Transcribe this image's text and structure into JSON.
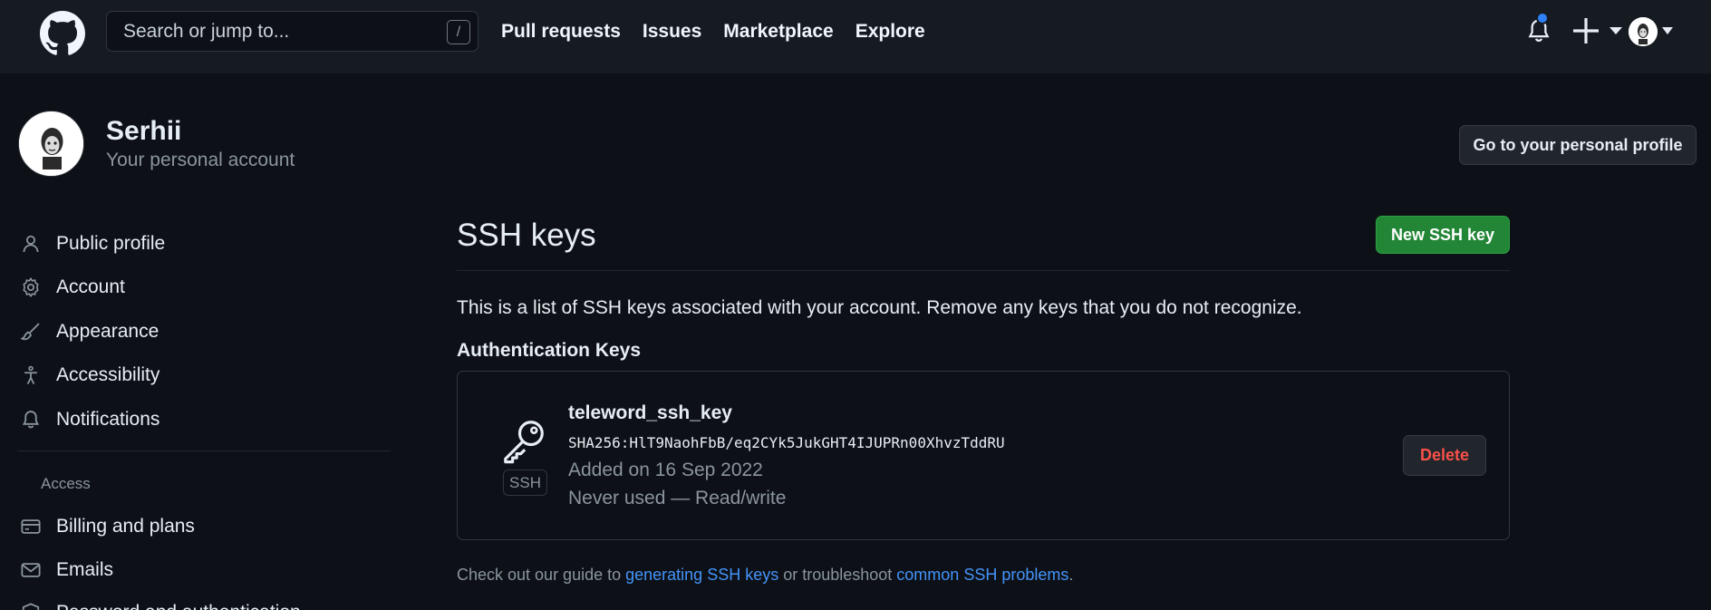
{
  "header": {
    "search_placeholder": "Search or jump to...",
    "search_shortcut": "/",
    "nav": [
      "Pull requests",
      "Issues",
      "Marketplace",
      "Explore"
    ],
    "icons": [
      "github-logo-icon",
      "bell-icon",
      "plus-icon",
      "avatar"
    ]
  },
  "profile": {
    "name": "Serhii",
    "subtitle": "Your personal account",
    "go_profile_button": "Go to your personal profile"
  },
  "sidebar": {
    "items": [
      {
        "label": "Public profile",
        "icon": "person-icon"
      },
      {
        "label": "Account",
        "icon": "gear-icon"
      },
      {
        "label": "Appearance",
        "icon": "paintbrush-icon"
      },
      {
        "label": "Accessibility",
        "icon": "accessibility-icon"
      },
      {
        "label": "Notifications",
        "icon": "bell-icon"
      }
    ],
    "access_heading": "Access",
    "access_items": [
      {
        "label": "Billing and plans",
        "icon": "credit-card-icon"
      },
      {
        "label": "Emails",
        "icon": "mail-icon"
      },
      {
        "label": "Password and authentication",
        "icon": "shield-lock-icon"
      }
    ]
  },
  "main": {
    "title": "SSH keys",
    "new_key_button": "New SSH key",
    "description": "This is a list of SSH keys associated with your account. Remove any keys that you do not recognize.",
    "section_title": "Authentication Keys",
    "key": {
      "name": "teleword_ssh_key",
      "fingerprint": "SHA256:HlT9NaohFbB/eq2CYk5JukGHT4IJUPRn00XhvzTddRU",
      "badge": "SSH",
      "added": "Added on 16 Sep 2022",
      "usage": "Never used — Read/write",
      "delete_button": "Delete"
    },
    "footer": {
      "prefix": "Check out our guide to ",
      "link1": "generating SSH keys",
      "middle": " or troubleshoot ",
      "link2": "common SSH problems",
      "suffix": "."
    }
  },
  "colors": {
    "background": "#0d1117",
    "header": "#161b22",
    "accent_green": "#238636",
    "danger": "#f85149",
    "link": "#4493f8",
    "notification_dot": "#2f81f7"
  }
}
